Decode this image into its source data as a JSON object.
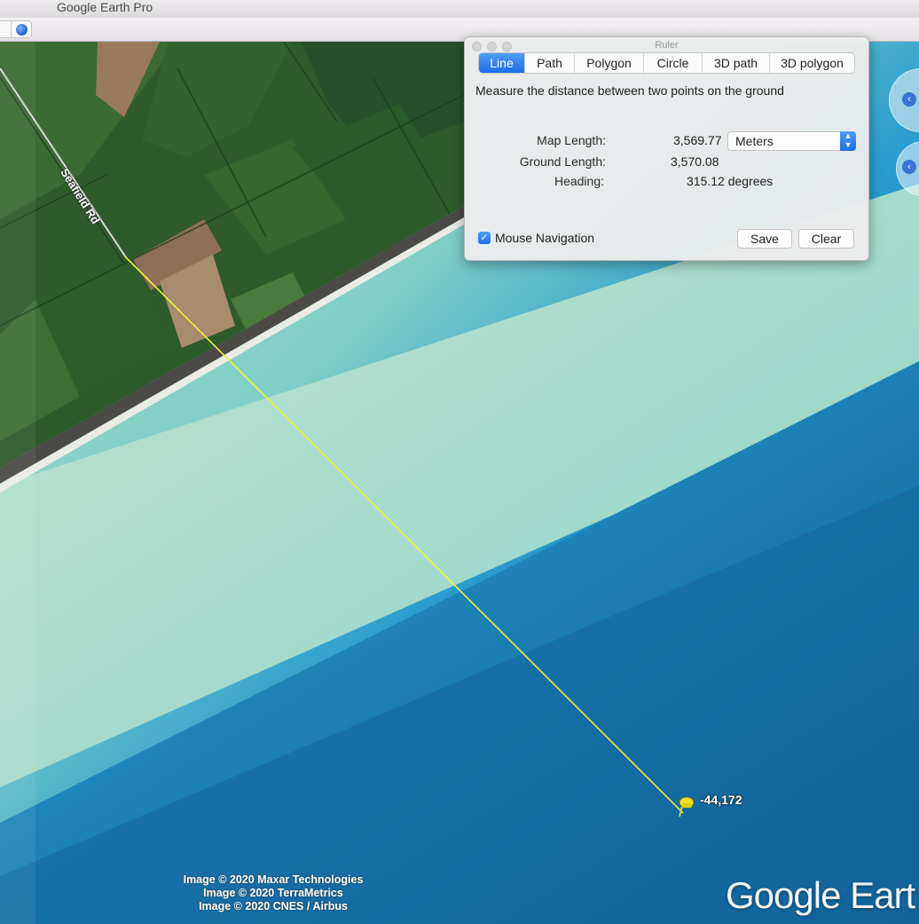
{
  "window": {
    "title": "Google Earth Pro"
  },
  "ruler": {
    "window_title": "Ruler",
    "tabs": [
      {
        "label": "Line",
        "active": true
      },
      {
        "label": "Path",
        "active": false
      },
      {
        "label": "Polygon",
        "active": false
      },
      {
        "label": "Circle",
        "active": false
      },
      {
        "label": "3D path",
        "active": false
      },
      {
        "label": "3D polygon",
        "active": false
      }
    ],
    "description": "Measure the distance between two points on the ground",
    "map_length_label": "Map Length:",
    "map_length_value": "3,569.77",
    "unit_selected": "Meters",
    "ground_length_label": "Ground Length:",
    "ground_length_value": "3,570.08",
    "heading_label": "Heading:",
    "heading_value": "315.12 degrees",
    "mouse_navigation_label": "Mouse Navigation",
    "mouse_navigation_checked": true,
    "save_label": "Save",
    "clear_label": "Clear"
  },
  "map": {
    "road_label": "Seafield Rd",
    "placemark_label": "-44,172",
    "credits": [
      "Image © 2020 Maxar Technologies",
      "Image © 2020 TerraMetrics",
      "Image © 2020 CNES / Airbus"
    ],
    "logo_text": "Google Eart",
    "measure_line_color": "#f2f23a",
    "pin_color": "#f0e020"
  },
  "icons": {
    "globe": "globe-icon",
    "pin": "pushpin-icon",
    "check": "checkmark-icon",
    "stepper": "up-down-chevron-icon",
    "nav_left": "chevron-left-icon"
  }
}
